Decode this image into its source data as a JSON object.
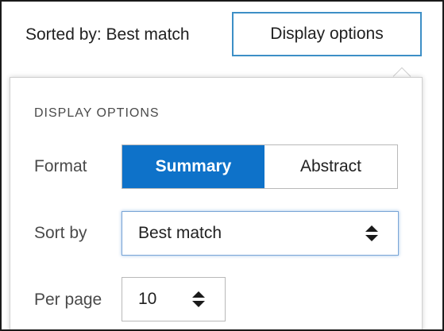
{
  "toolbar": {
    "sorted_by_text": "Sorted by: Best match",
    "display_options_label": "Display options"
  },
  "panel": {
    "heading": "DISPLAY OPTIONS",
    "format": {
      "label": "Format",
      "options": [
        "Summary",
        "Abstract"
      ],
      "selected": "Summary"
    },
    "sort_by": {
      "label": "Sort by",
      "value": "Best match"
    },
    "per_page": {
      "label": "Per page",
      "value": "10"
    }
  },
  "colors": {
    "accent": "#0e72c9",
    "button_border": "#3d8fc6",
    "focus_border": "#7aa6d6"
  },
  "icons": [
    "updown-arrows-icon"
  ]
}
